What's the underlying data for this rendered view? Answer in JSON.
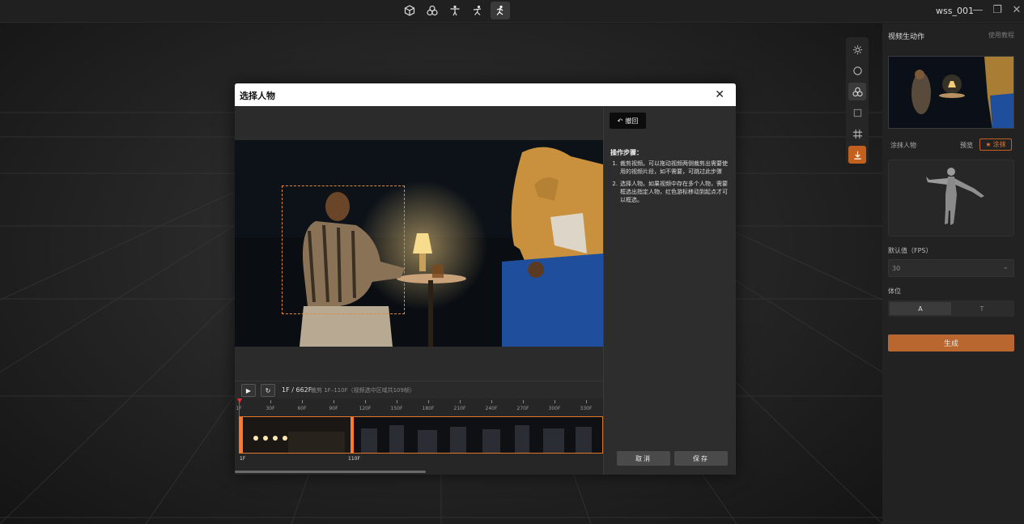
{
  "window": {
    "title": "wss_001"
  },
  "right_panel": {
    "title": "视频生动作",
    "help": "使用教程",
    "paint_person_label": "涂抹人物",
    "preview_label": "预览",
    "paint_button": "涂抹",
    "fps_label": "默认值（FPS）",
    "fps_value": "30",
    "pose_label": "体位",
    "pose_options": [
      "A",
      "T"
    ],
    "pose_selected": "A",
    "generate_button": "生成"
  },
  "modal": {
    "title": "选择人物",
    "frame_info": "1F / 662F",
    "crop_info": "裁剪 1F–110F（视频选中区域共109帧）",
    "ruler_labels": [
      "1F",
      "30F",
      "60F",
      "90F",
      "120F",
      "150F",
      "180F",
      "210F",
      "240F",
      "270F",
      "300F",
      "330F"
    ],
    "trim_start_label": "1F",
    "trim_end_label": "110F",
    "undo_button": "撤回",
    "steps_title": "操作步骤：",
    "steps": [
      {
        "num": "1.",
        "text": "裁剪视频。可以拖动视频两侧裁剪出需要使用的视频片段，如不需要，可跳过此步骤"
      },
      {
        "num": "2.",
        "text": "选择人物。如果视频中存在多个人物，需要框选出指定人物，红色游标移动到起点才可以框选。"
      }
    ],
    "cancel_button": "取消",
    "save_button": "保存"
  },
  "colors": {
    "accent": "#c2601f",
    "selection": "#e08a3a",
    "playhead": "#e23232"
  }
}
